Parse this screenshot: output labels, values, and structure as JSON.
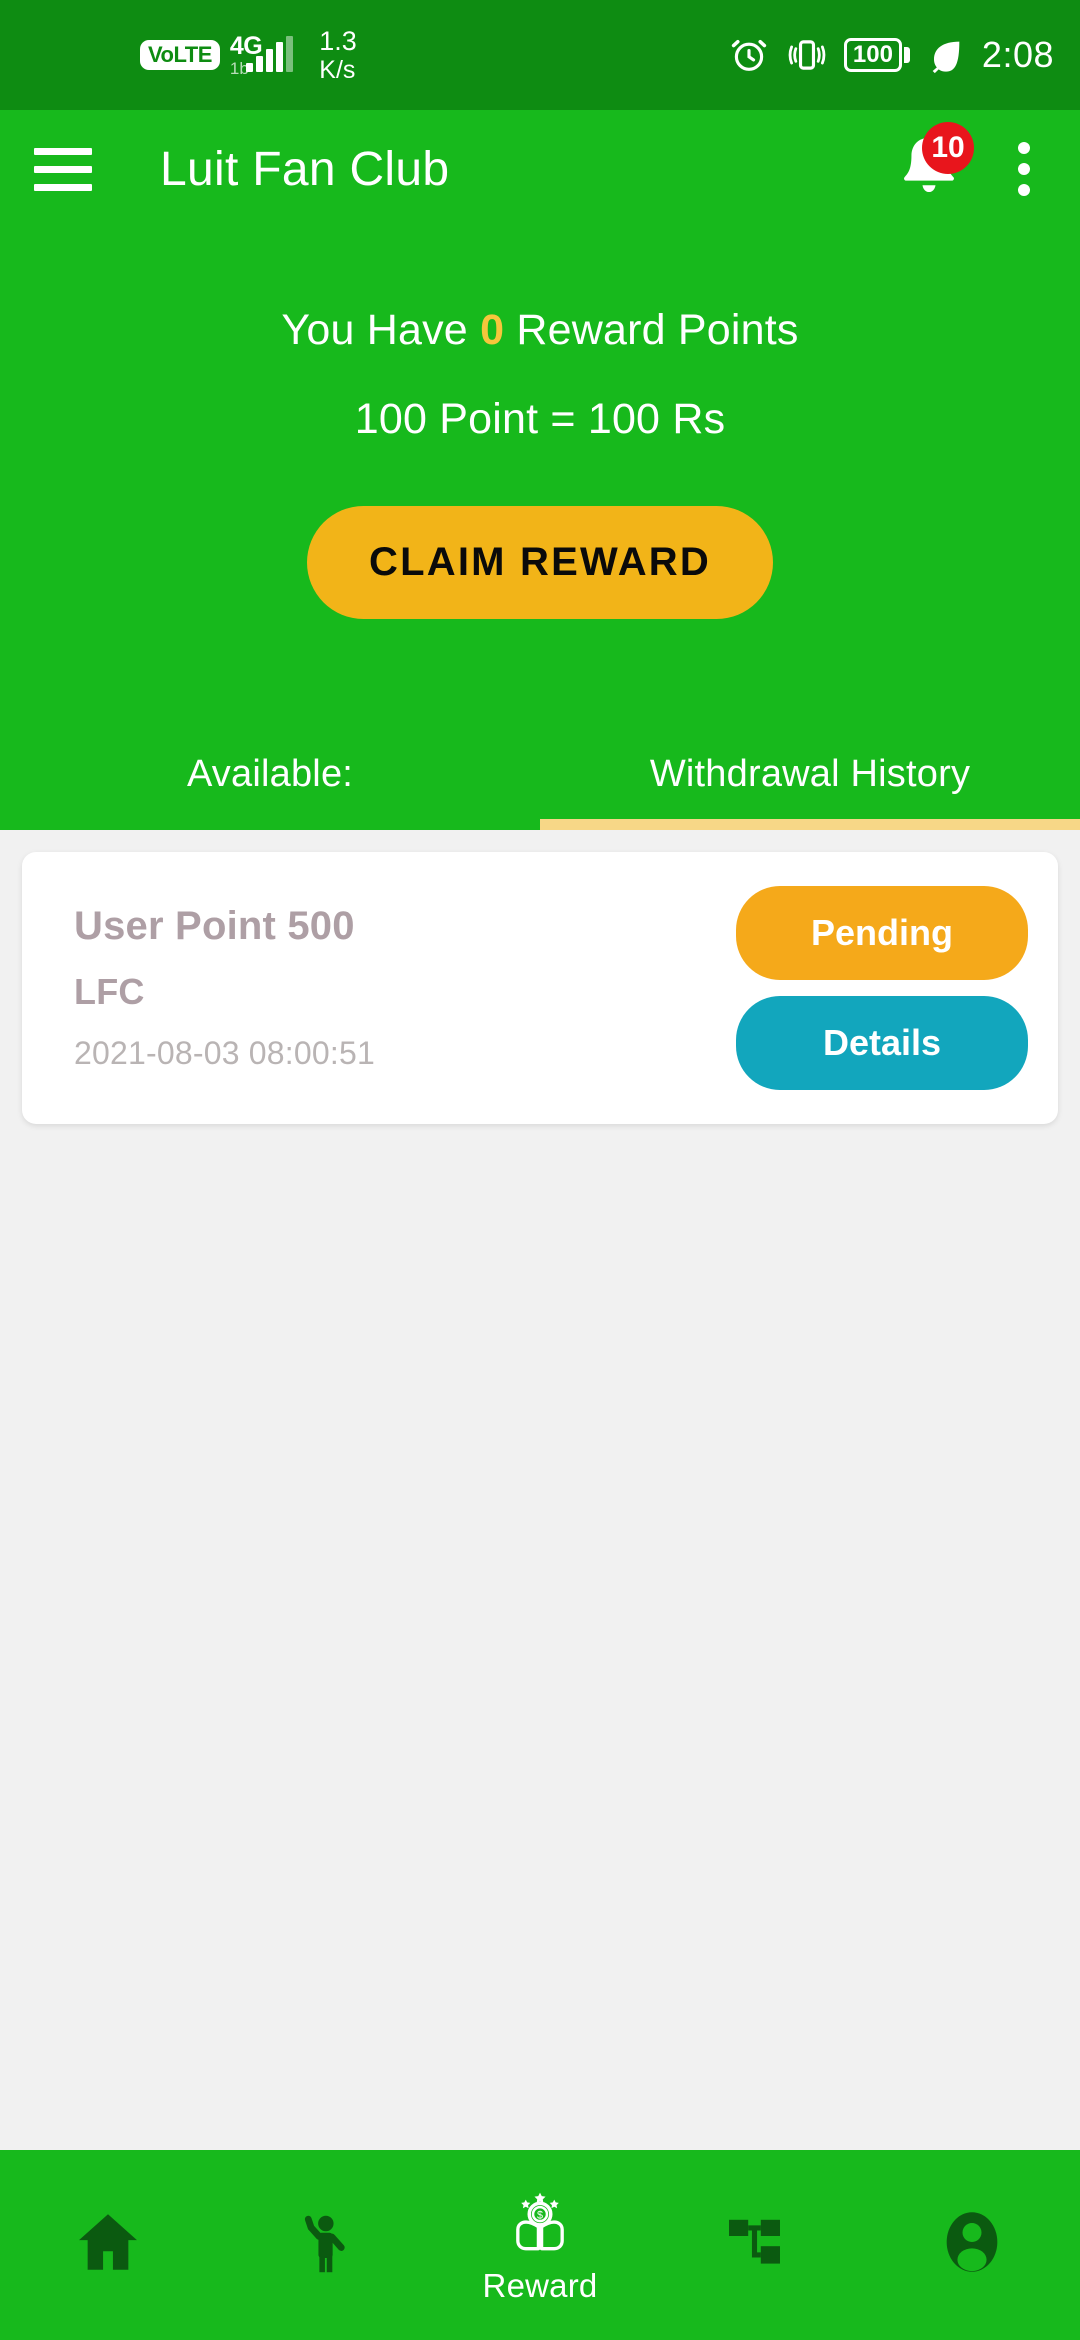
{
  "status_bar": {
    "volte_label": "VoLTE",
    "network_type": "4G",
    "network_sub": "1b",
    "data_speed_value": "1.3",
    "data_speed_unit": "K/s",
    "battery_percent": "100",
    "time": "2:08",
    "icons": [
      "volte-icon",
      "signal-bars-icon",
      "alarm-clock-icon",
      "vibrate-icon",
      "battery-icon",
      "leaf-icon"
    ]
  },
  "app_bar": {
    "menu_icon": "hamburger-menu-icon",
    "title": "Luit Fan Club",
    "notification_icon": "bell-icon",
    "notification_count": "10",
    "overflow_icon": "kebab-menu-icon"
  },
  "hero": {
    "points_prefix": "You Have",
    "points_value": "0",
    "points_suffix": "Reward Points",
    "conversion": "100 Point = 100 Rs",
    "claim_button": "CLAIM REWARD"
  },
  "tabs": {
    "items": [
      {
        "label": "Available:",
        "active": false
      },
      {
        "label": "Withdrawal History",
        "active": true
      }
    ]
  },
  "history": {
    "rows": [
      {
        "title": "User Point 500",
        "subtitle": "LFC",
        "timestamp": "2021-08-03 08:00:51",
        "status_label": "Pending",
        "details_label": "Details"
      }
    ]
  },
  "bottom_nav": {
    "items": [
      {
        "label": "",
        "icon": "home-icon",
        "active": false
      },
      {
        "label": "",
        "icon": "person-waving-icon",
        "active": false
      },
      {
        "label": "Reward",
        "icon": "hands-holding-coin-icon",
        "active": true
      },
      {
        "label": "",
        "icon": "network-tree-icon",
        "active": false
      },
      {
        "label": "",
        "icon": "account-circle-icon",
        "active": false
      }
    ]
  },
  "colors": {
    "status_bar_green": "#0E8C12",
    "brand_green": "#17B91C",
    "accent_amber": "#F2B418",
    "status_pending_amber": "#F5A91A",
    "details_teal": "#12A6BD",
    "badge_red": "#E8151C",
    "tab_indicator": "#F7D787",
    "points_yellow": "#F6C63C",
    "content_bg": "#F1F1F1",
    "nav_inactive": "#0B5A10"
  }
}
